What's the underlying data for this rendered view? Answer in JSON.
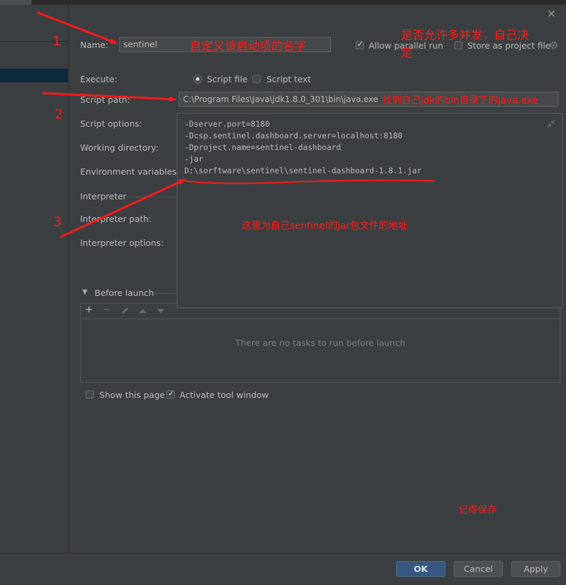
{
  "dialog": {
    "close_label": "×",
    "name_label": "Name:",
    "name_value": "sentinel",
    "allow_parallel_label": "Allow parallel run",
    "allow_parallel_checked": true,
    "store_project_label": "Store as project file",
    "execute_label": "Execute:",
    "execute_options": [
      "Script file",
      "Script text"
    ],
    "execute_selected": "Script file",
    "script_path_label": "Script path:",
    "script_path_value": "C:\\Program Files\\Java\\jdk1.8.0_301\\bin\\java.exe",
    "script_options_label": "Script options:",
    "working_dir_label": "Working directory:",
    "env_vars_label": "Environment variables:",
    "interpreter_section": "Interpreter",
    "interpreter_path_label": "Interpreter path:",
    "interpreter_options_label": "Interpreter options:",
    "script_options_lines": [
      "-Dserver.port=8180",
      "-Dcsp.sentinel.dashboard.server=localhost:8180",
      "-Dproject.name=sentinel-dashboard",
      "-jar",
      "D:\\sorftware\\sentinel\\sentinel-dashboard-1.8.1.jar"
    ],
    "before_launch_label": "Before launch",
    "before_launch_empty": "There are no tasks to run before launch",
    "toolbar_icons": [
      "plus-icon",
      "minus-icon",
      "edit-icon",
      "up-icon",
      "down-icon"
    ],
    "show_page_label": "Show this page",
    "show_page_checked": false,
    "activate_tool_label": "Activate tool window",
    "activate_tool_checked": true
  },
  "footer": {
    "ok_label": "OK",
    "cancel_label": "Cancel",
    "apply_label": "Apply"
  },
  "annotations": {
    "num1": "1",
    "num2": "2",
    "num3": "3",
    "name_note": "自定义该启动项的名字",
    "parallel_note_line1": "是否允许多并发，自己决",
    "parallel_note_line2": "定",
    "java_note": "找到自己jdk的bin目录下的java.exe",
    "jar_note": "这里为自己sentinel的jar包文件的地址",
    "save_note": "记得保存",
    "color": "#ff1a1a"
  }
}
